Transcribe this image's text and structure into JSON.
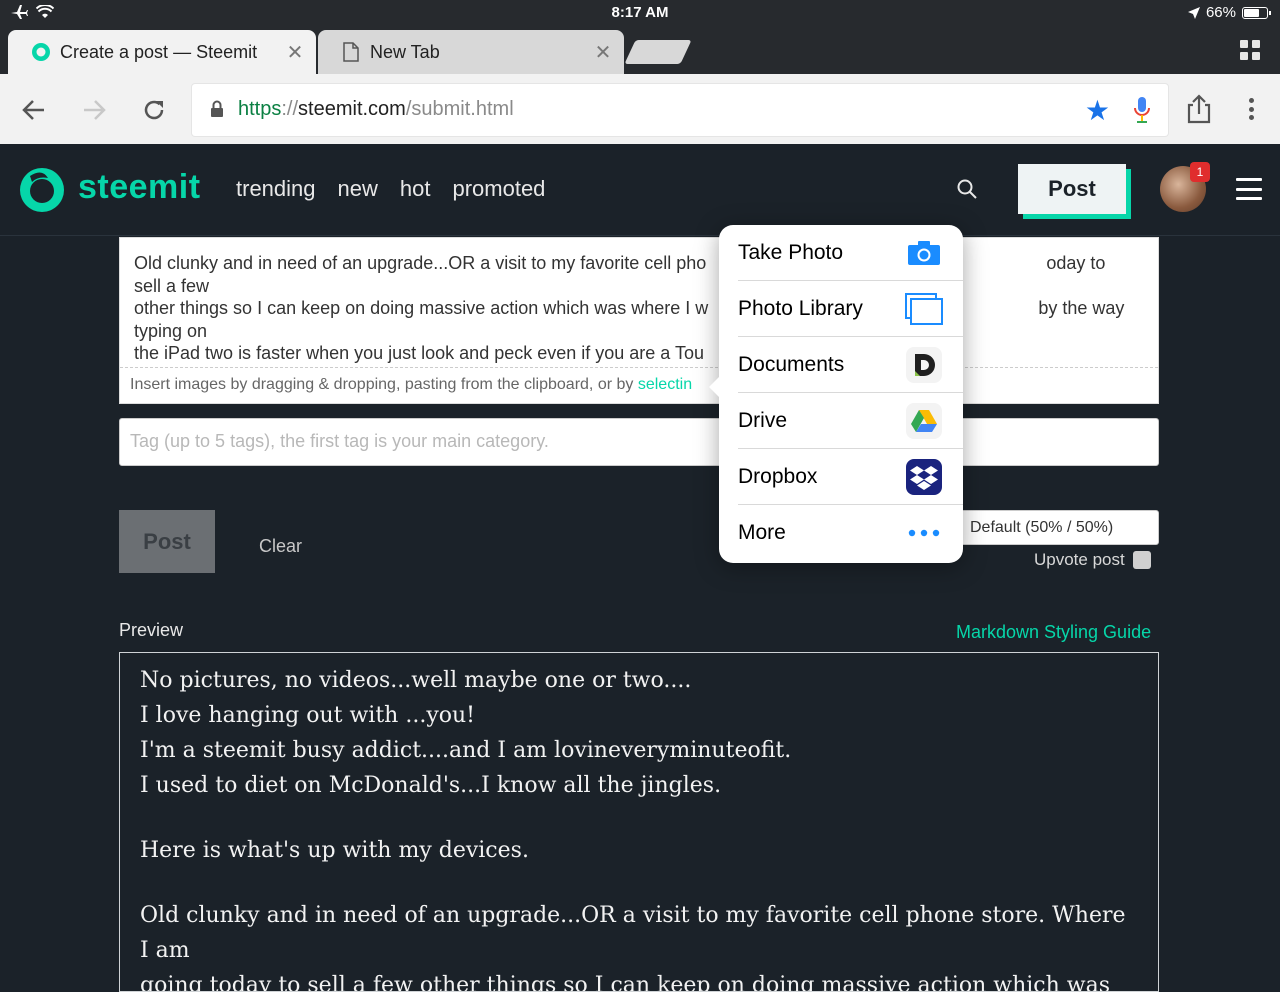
{
  "statusbar": {
    "time": "8:17 AM",
    "battery": "66%"
  },
  "tabs": [
    {
      "title": "Create a post — Steemit",
      "active": true
    },
    {
      "title": "New Tab",
      "active": false
    }
  ],
  "address": {
    "scheme": "https",
    "sep": "://",
    "domain": "steemit.com",
    "path": "/submit.html"
  },
  "header": {
    "brand": "steemit",
    "nav": [
      "trending",
      "new",
      "hot",
      "promoted"
    ],
    "post_label": "Post",
    "notification_count": "1"
  },
  "editor": {
    "body": "Old clunky and in need of an upgrade...OR a visit to my favorite cell pho                                                                    oday to sell a few\nother things so I can keep on doing massive action which was where I w                                                                  by the way typing on\nthe iPad two is faster when you just look and peck even if you are a Tou",
    "footer_text": "Insert images by dragging & dropping, pasting from the clipboard, or by ",
    "footer_link": "selectin",
    "tags_placeholder": "Tag (up to 5 tags), the first tag is your main category."
  },
  "actions": {
    "post": "Post",
    "clear": "Clear",
    "rewards": "Default (50% / 50%)",
    "upvote": "Upvote post"
  },
  "preview": {
    "label": "Preview",
    "guide": "Markdown Styling Guide",
    "lines": [
      "No pictures, no videos...well maybe one or two....",
      "I love hanging out with ...you!",
      "I'm a steemit busy addict....and I am lovineveryminuteofit.",
      "I used to diet on McDonald's...I know all the jingles.",
      "Here is what's up with my devices.",
      "Old clunky and in need of an upgrade...OR a visit to my favorite cell phone store. Where I am",
      "going today to sell a few other things so I can keep on doing massive action which was where I"
    ]
  },
  "popover": {
    "items": [
      {
        "label": "Take Photo",
        "icon": "camera-icon"
      },
      {
        "label": "Photo Library",
        "icon": "photo-library-icon"
      },
      {
        "label": "Documents",
        "icon": "documents-icon"
      },
      {
        "label": "Drive",
        "icon": "google-drive-icon"
      },
      {
        "label": "Dropbox",
        "icon": "dropbox-icon"
      },
      {
        "label": "More",
        "icon": "more-icon"
      }
    ]
  },
  "colors": {
    "accent": "#06d6a9",
    "background": "#1b2229",
    "ios_blue": "#1a73e8"
  }
}
